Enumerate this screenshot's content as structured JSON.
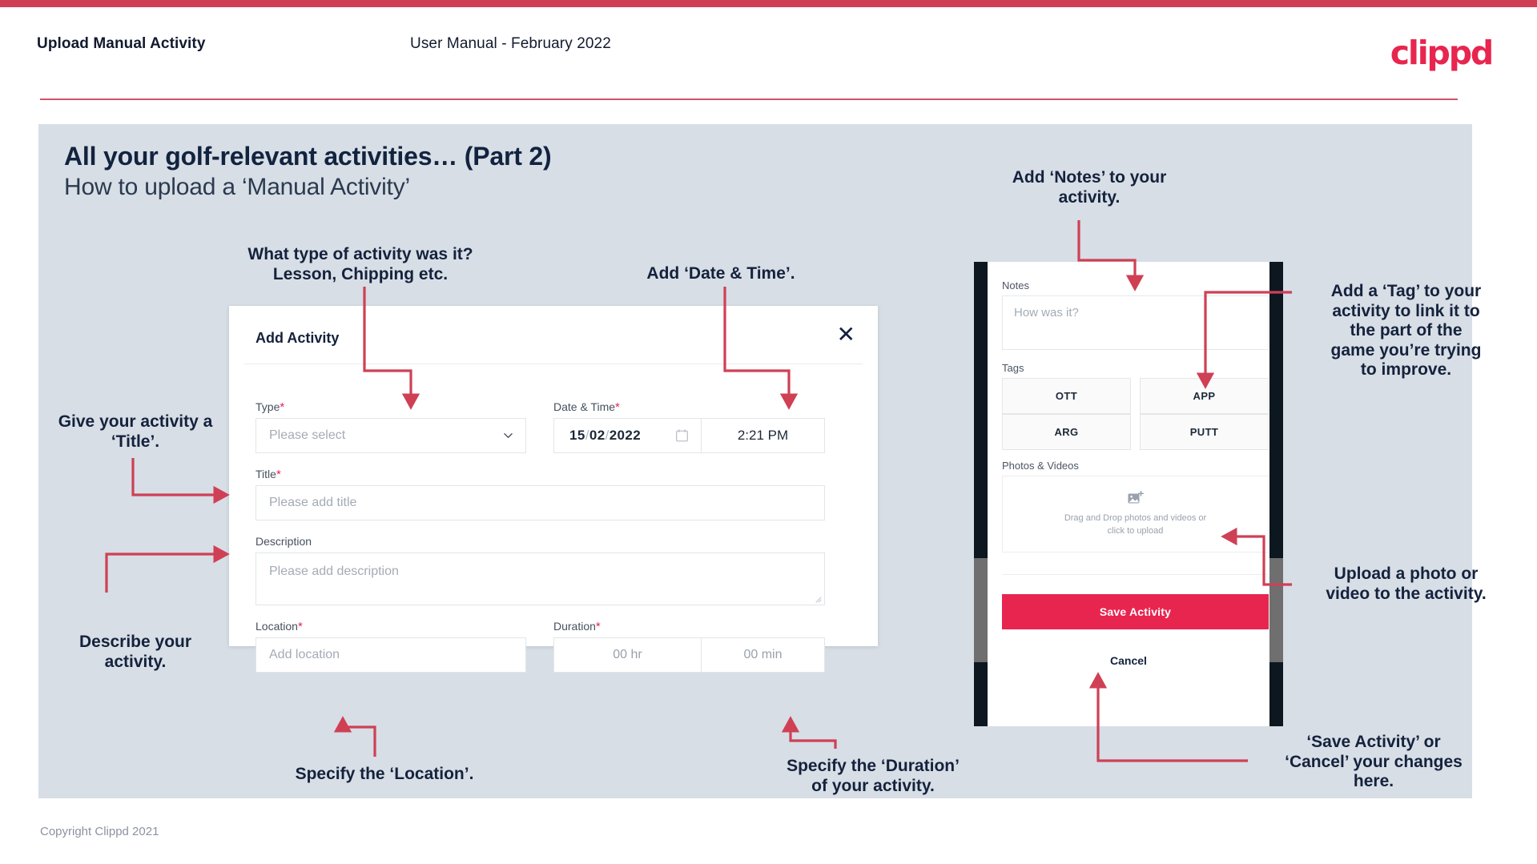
{
  "header": {
    "title": "Upload Manual Activity",
    "subtitle": "User Manual - February 2022",
    "brand": "clippd"
  },
  "slide": {
    "title": "All your golf-relevant activities… (Part 2)",
    "subtitle": "How to upload a ‘Manual Activity’"
  },
  "footer": {
    "copyright": "Copyright Clippd 2021"
  },
  "colors": {
    "accent": "#e8254f",
    "top_bar": "#cf4055",
    "slide_bg": "#d7dee6",
    "arrow": "#cf4055",
    "heading": "#12233f"
  },
  "annotations": {
    "type": "What type of activity was it?\nLesson, Chipping etc.",
    "type_line1": "What type of activity was it?",
    "type_line2": "Lesson, Chipping etc.",
    "datetime": "Add ‘Date & Time’.",
    "title": "Give your activity a\n‘Title’.",
    "title_line1": "Give your activity a",
    "title_line2": "‘Title’.",
    "describe_line1": "Describe your",
    "describe_line2": "activity.",
    "location": "Specify the ‘Location’.",
    "duration_line1": "Specify the ‘Duration’",
    "duration_line2": "of your activity.",
    "notes_line1": "Add ‘Notes’ to your",
    "notes_line2": "activity.",
    "tag_line1": "Add a ‘Tag’ to your",
    "tag_line2": "activity to link it to",
    "tag_line3": "the part of the",
    "tag_line4": "game you’re trying",
    "tag_line5": "to improve.",
    "upload_line1": "Upload a photo or",
    "upload_line2": "video to the activity.",
    "save_line1": "‘Save Activity’ or",
    "save_line2": "‘Cancel’ your changes",
    "save_line3": "here."
  },
  "dialog": {
    "title": "Add Activity",
    "close_icon": "close-icon",
    "fields": {
      "type": {
        "label": "Type",
        "required": "*",
        "placeholder": "Please select",
        "icon": "chevron-down-icon"
      },
      "datetime": {
        "label": "Date & Time",
        "required": "*",
        "day": "15",
        "month": "02",
        "year": "2022",
        "sep": "/",
        "icon": "calendar-icon",
        "time": "2:21 PM"
      },
      "title": {
        "label": "Title",
        "required": "*",
        "placeholder": "Please add title"
      },
      "description": {
        "label": "Description",
        "required": "",
        "placeholder": "Please add description"
      },
      "location": {
        "label": "Location",
        "required": "*",
        "placeholder": "Add location"
      },
      "duration": {
        "label": "Duration",
        "required": "*",
        "hours": "00 hr",
        "minutes": "00 min"
      }
    }
  },
  "phone": {
    "notes": {
      "label": "Notes",
      "placeholder": "How was it?"
    },
    "tags": {
      "label": "Tags",
      "items": [
        "OTT",
        "APP",
        "ARG",
        "PUTT"
      ]
    },
    "media": {
      "label": "Photos & Videos",
      "icon": "add-image-icon",
      "hint_line1": "Drag and Drop photos and videos or",
      "hint_line2": "click to upload"
    },
    "save_label": "Save Activity",
    "cancel_label": "Cancel"
  }
}
